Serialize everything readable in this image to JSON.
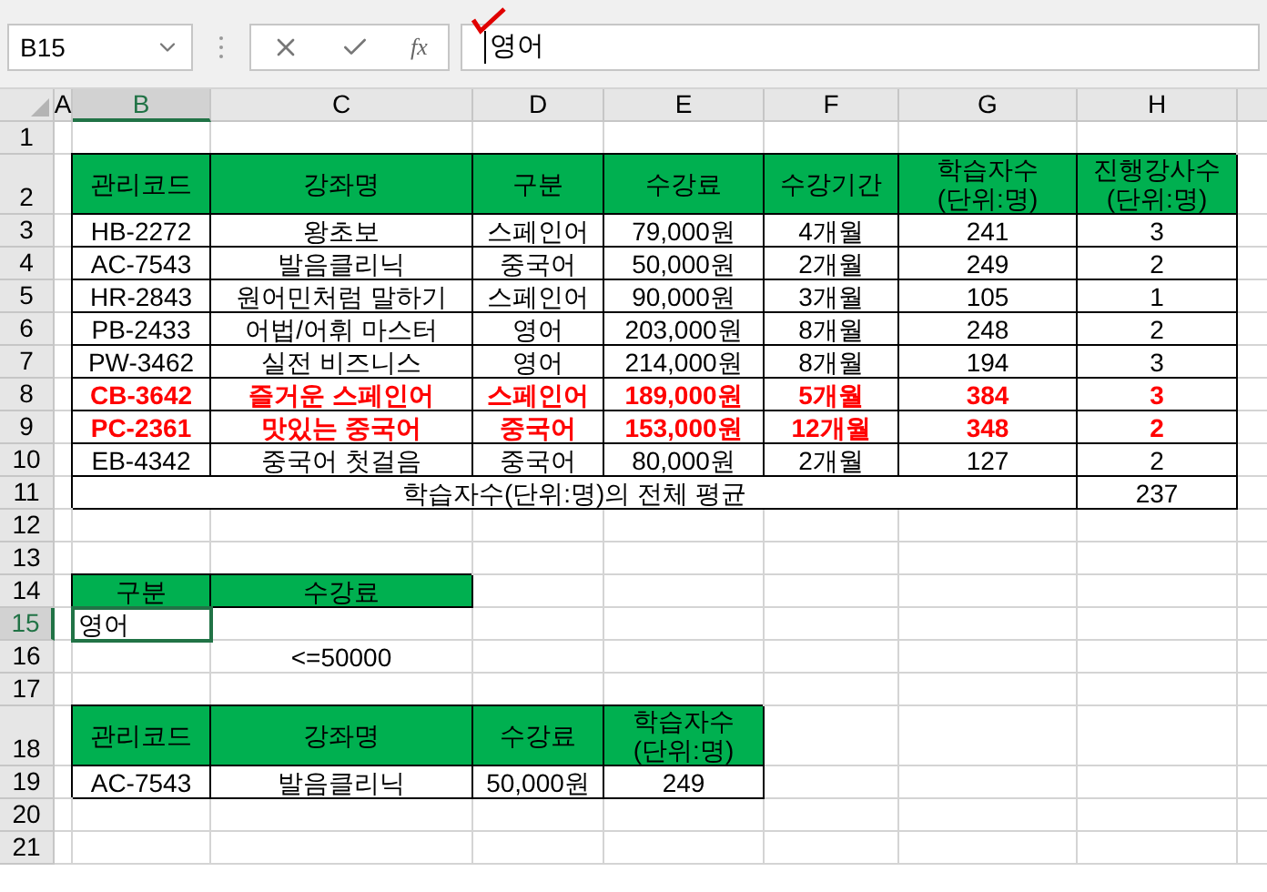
{
  "name_box": {
    "value": "B15"
  },
  "formula_bar": {
    "function_label": "fx",
    "value": "영어"
  },
  "columns": [
    {
      "label": "A",
      "selected": false
    },
    {
      "label": "B",
      "selected": true
    },
    {
      "label": "C",
      "selected": false
    },
    {
      "label": "D",
      "selected": false
    },
    {
      "label": "E",
      "selected": false
    },
    {
      "label": "F",
      "selected": false
    },
    {
      "label": "G",
      "selected": false
    },
    {
      "label": "H",
      "selected": false
    }
  ],
  "row_numbers": [
    {
      "label": "1",
      "selected": false
    },
    {
      "label": "2",
      "selected": false
    },
    {
      "label": "3",
      "selected": false
    },
    {
      "label": "4",
      "selected": false
    },
    {
      "label": "5",
      "selected": false
    },
    {
      "label": "6",
      "selected": false
    },
    {
      "label": "7",
      "selected": false
    },
    {
      "label": "8",
      "selected": false
    },
    {
      "label": "9",
      "selected": false
    },
    {
      "label": "10",
      "selected": false
    },
    {
      "label": "11",
      "selected": false
    },
    {
      "label": "12",
      "selected": false
    },
    {
      "label": "13",
      "selected": false
    },
    {
      "label": "14",
      "selected": false
    },
    {
      "label": "15",
      "selected": true
    },
    {
      "label": "16",
      "selected": false
    },
    {
      "label": "17",
      "selected": false
    },
    {
      "label": "18",
      "selected": false
    },
    {
      "label": "19",
      "selected": false
    },
    {
      "label": "20",
      "selected": false
    },
    {
      "label": "21",
      "selected": false
    }
  ],
  "main_table": {
    "headers": [
      "관리코드",
      "강좌명",
      "구분",
      "수강료",
      "수강기간",
      "학습자수 (단위:명)",
      "진행강사수 (단위:명)"
    ],
    "rows": [
      {
        "highlighted": false,
        "cells": [
          "HB-2272",
          "왕초보",
          "스페인어",
          "79,000원",
          "4개월",
          "241",
          "3"
        ]
      },
      {
        "highlighted": false,
        "cells": [
          "AC-7543",
          "발음클리닉",
          "중국어",
          "50,000원",
          "2개월",
          "249",
          "2"
        ]
      },
      {
        "highlighted": false,
        "cells": [
          "HR-2843",
          "원어민처럼 말하기",
          "스페인어",
          "90,000원",
          "3개월",
          "105",
          "1"
        ]
      },
      {
        "highlighted": false,
        "cells": [
          "PB-2433",
          "어법/어휘 마스터",
          "영어",
          "203,000원",
          "8개월",
          "248",
          "2"
        ]
      },
      {
        "highlighted": false,
        "cells": [
          "PW-3462",
          "실전 비즈니스",
          "영어",
          "214,000원",
          "8개월",
          "194",
          "3"
        ]
      },
      {
        "highlighted": true,
        "cells": [
          "CB-3642",
          "즐거운 스페인어",
          "스페인어",
          "189,000원",
          "5개월",
          "384",
          "3"
        ]
      },
      {
        "highlighted": true,
        "cells": [
          "PC-2361",
          "맛있는 중국어",
          "중국어",
          "153,000원",
          "12개월",
          "348",
          "2"
        ]
      },
      {
        "highlighted": false,
        "cells": [
          "EB-4342",
          "중국어 첫걸음",
          "중국어",
          "80,000원",
          "2개월",
          "127",
          "2"
        ]
      }
    ],
    "summary": {
      "label": "학습자수(단위:명)의 전체 평균",
      "value": "237"
    }
  },
  "criteria": {
    "headers": [
      "구분",
      "수강료"
    ],
    "category_value": {
      "text": "영어",
      "selected": true
    },
    "fee_condition": "<=50000"
  },
  "result_table": {
    "headers": [
      "관리코드",
      "강좌명",
      "수강료",
      "학습자수 (단위:명)"
    ],
    "rows": [
      [
        "AC-7543",
        "발음클리닉",
        "50,000원",
        "249"
      ]
    ]
  }
}
